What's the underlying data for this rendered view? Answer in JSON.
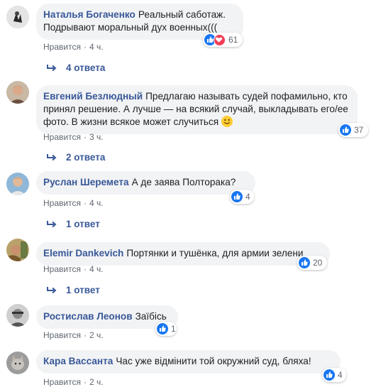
{
  "comments": [
    {
      "author": "Наталья Богаченко",
      "text": "Реальный саботаж. Подрывают моральный дух военных(((",
      "like_label": "Нравится",
      "time": "4 ч.",
      "reaction_count": "61",
      "replies": "4 ответа"
    },
    {
      "author": "Евгений Безлюдный",
      "text": "Предлагаю называть судей пофамильно, кто принял решение. А лучше — на всякий случай, выкладывать его/ее фото. В жизни всякое может случиться",
      "like_label": "Нравится",
      "time": "3 ч.",
      "reaction_count": "37",
      "replies": "2 ответа"
    },
    {
      "author": "Руслан Шеремета",
      "text": "А де заява Полторака?",
      "like_label": "Нравится",
      "time": "4 ч.",
      "reaction_count": "4",
      "replies": "1 ответ"
    },
    {
      "author": "Elemir Dankevich",
      "text": "Портянки и тушёнка, для армии зелени",
      "like_label": "Нравится",
      "time": "4 ч.",
      "reaction_count": "20",
      "replies": "1 ответ"
    },
    {
      "author": "Ростислав Леонов",
      "text": "Заїбісь",
      "like_label": "Нравится",
      "time": "2 ч.",
      "reaction_count": "1"
    },
    {
      "author": "Кара Вассанта",
      "text": "Час уже відмінити той окружний суд, бляха!",
      "like_label": "Нравится",
      "time": "2 ч.",
      "reaction_count": "4"
    }
  ],
  "colors": {
    "author": "#385898",
    "bubble": "#f2f3f5",
    "meta": "#606770",
    "like": "#1877f2",
    "love": "#f33e58"
  },
  "icons": {
    "like": "thumbs-up-icon",
    "love": "heart-icon",
    "reply_arrow": "reply-arrow-icon",
    "emoji": "smiley-emoji-icon"
  }
}
